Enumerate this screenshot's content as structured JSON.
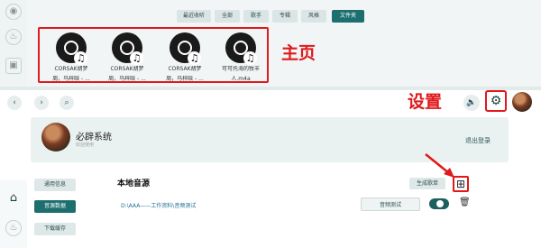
{
  "colors": {
    "accent": "#1d6f6f",
    "highlight": "#e0191b"
  },
  "tabs": [
    {
      "label": "最近收听",
      "active": false
    },
    {
      "label": "全部",
      "active": false
    },
    {
      "label": "歌手",
      "active": false
    },
    {
      "label": "专辑",
      "active": false
    },
    {
      "label": "风格",
      "active": false
    },
    {
      "label": "文件夹",
      "active": true
    }
  ],
  "songs": [
    {
      "title_line1": "CORSAK胡梦",
      "title_line2": "周，马梓晗 - ..."
    },
    {
      "title_line1": "CORSAK胡梦",
      "title_line2": "周，马梓晗 - ..."
    },
    {
      "title_line1": "CORSAK胡梦",
      "title_line2": "周，马梓晗 - ..."
    },
    {
      "title_line1": "可可托海的牧羊",
      "title_line2": "人.m4a"
    }
  ],
  "annotations": {
    "home": "主页",
    "settings": "设置"
  },
  "profile": {
    "name": "必辟系统",
    "subtitle": "欢迎使用",
    "logout": "退出登录"
  },
  "sidebar": [
    {
      "label": "通用信息",
      "active": false
    },
    {
      "label": "音源数据",
      "active": true
    },
    {
      "label": "下载缓存",
      "active": false
    }
  ],
  "source": {
    "title": "本地音源",
    "generate_button": "生成歌单",
    "path": "D:\\AAA——工作资料\\音频测试",
    "test_button": "音频测试"
  }
}
